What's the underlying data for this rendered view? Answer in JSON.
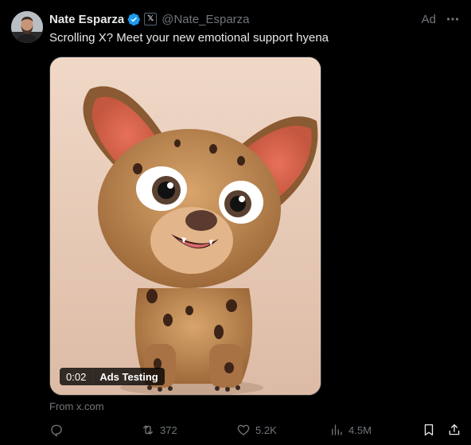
{
  "author": {
    "name": "Nate Esparza",
    "handle": "@Nate_Esparza",
    "affiliate_badge": "𝕏",
    "verified_color": "#1d9bf0"
  },
  "ad_label": "Ad",
  "tweet_text": "Scrolling X? Meet your new emotional support hyena",
  "media": {
    "type": "video",
    "duration": "0:02",
    "source_label": "Ads Testing"
  },
  "from_link": "From x.com",
  "actions": {
    "reply": "",
    "reposts": "372",
    "likes": "5.2K",
    "views": "4.5M"
  },
  "colors": {
    "background": "#000000",
    "text_primary": "#e7e9ea",
    "text_secondary": "#71767b",
    "accent": "#1d9bf0"
  },
  "icons": [
    "verified-icon",
    "more-icon",
    "reply-icon",
    "repost-icon",
    "like-icon",
    "views-icon",
    "bookmark-icon",
    "share-icon"
  ]
}
